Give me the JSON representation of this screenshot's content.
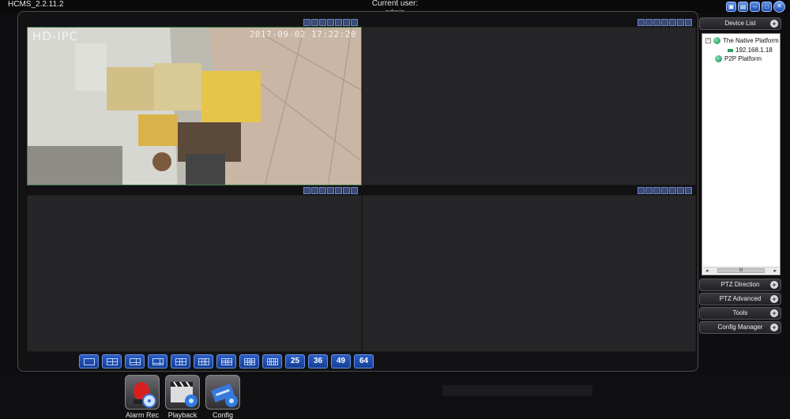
{
  "app": {
    "title": "HCMS_2.2.11.2",
    "current_user_label": "Current user:",
    "current_user_name": "admin"
  },
  "panes": [
    {
      "osd_name": "HD-IPC",
      "osd_time": "2017-09-02  17:22:20",
      "active": true
    },
    {
      "osd_name": "",
      "osd_time": "",
      "active": false
    },
    {
      "osd_name": "",
      "osd_time": "",
      "active": false
    },
    {
      "osd_name": "",
      "osd_time": "",
      "active": false
    }
  ],
  "layout_buttons": [
    "1",
    "4",
    "6",
    "8",
    "9",
    "10",
    "13",
    "16",
    "16b",
    "25",
    "36",
    "49",
    "64"
  ],
  "layout_numbered": {
    "b25": "25",
    "b36": "36",
    "b49": "49",
    "b64": "64"
  },
  "right_panel": {
    "device_list": "Device List",
    "tree": {
      "platform": "The Native Platform",
      "device_ip": "192.168.1.18",
      "p2p": "P2P Platform"
    },
    "scroll_thumb": "III",
    "ptz_direction": "PTZ Direction",
    "ptz_advanced": "PTZ Advanced",
    "tools": "Tools",
    "config_manager": "Config Manager"
  },
  "launchers": {
    "alarm": "Alarm Rec",
    "playback": "Playback",
    "config": "Config"
  },
  "colors": {
    "accent": "#2a5cc2",
    "active_border": "#3f7a4a",
    "pane_bg": "#262628"
  }
}
